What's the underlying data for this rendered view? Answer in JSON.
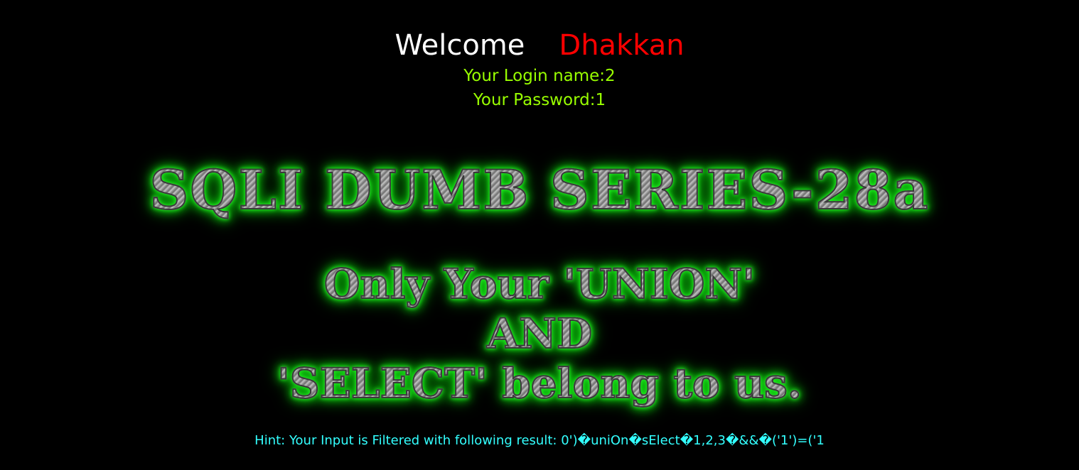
{
  "welcome": {
    "greeting": "Welcome",
    "user": "Dhakkan"
  },
  "login": {
    "name_line": "Your Login name:2",
    "password_line": "Your Password:1"
  },
  "banner": {
    "title": "SQLI DUMB SERIES-28a",
    "slogan_lines": [
      "Only Your 'UNION'",
      "AND",
      "'SELECT' belong to us."
    ]
  },
  "hint": {
    "text": "Hint: Your Input is Filtered with following result: 0')�uniOn�sElect�1,2,3�&&�('1')=('1"
  },
  "colors": {
    "background": "#000000",
    "greeting": "#ffffff",
    "user": "#ff0000",
    "login_info": "#99ff00",
    "hint": "#33ffff",
    "banner_glow": "#22ff22"
  }
}
